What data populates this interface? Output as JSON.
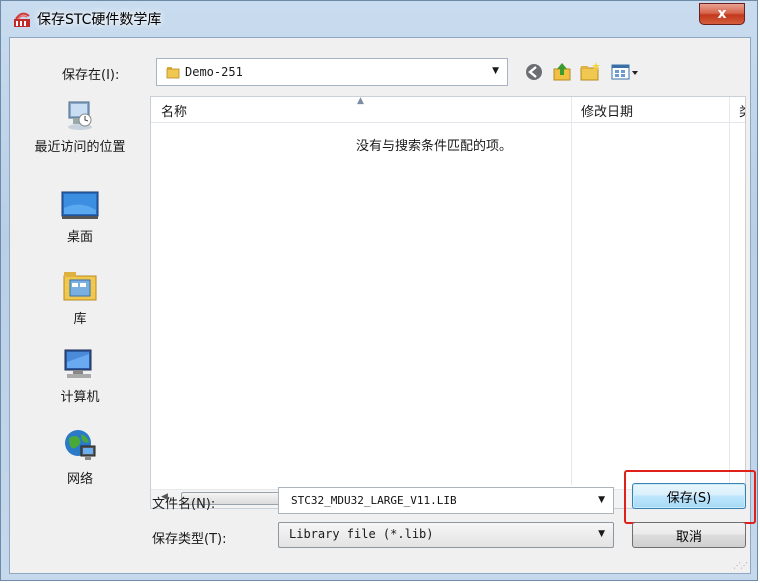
{
  "window": {
    "title": "保存STC硬件数学库",
    "close_label": "x"
  },
  "save_in": {
    "label": "保存在(I):",
    "value": "Demo-251"
  },
  "toolbar": {
    "icons": [
      "back-icon",
      "up-folder-icon",
      "new-folder-icon",
      "view-menu-icon"
    ]
  },
  "places": [
    {
      "label": "最近访问的位置",
      "icon": "recent-places-icon"
    },
    {
      "label": "桌面",
      "icon": "desktop-icon"
    },
    {
      "label": "库",
      "icon": "libraries-icon"
    },
    {
      "label": "计算机",
      "icon": "computer-icon"
    },
    {
      "label": "网络",
      "icon": "network-icon"
    }
  ],
  "file_list": {
    "columns": [
      "名称",
      "修改日期",
      "类"
    ],
    "empty_message": "没有与搜索条件匹配的项。",
    "scroll_thumb_label": "III"
  },
  "file_name": {
    "label": "文件名(N):",
    "value": "STC32_MDU32_LARGE_V11.LIB"
  },
  "file_type": {
    "label": "保存类型(T):",
    "value": "Library file (*.lib)"
  },
  "buttons": {
    "save": "保存(S)",
    "cancel": "取消"
  },
  "colors": {
    "highlight": "#e0201a",
    "default_button_border": "#3c7fb1",
    "window_frame": "#b9cfe6"
  }
}
